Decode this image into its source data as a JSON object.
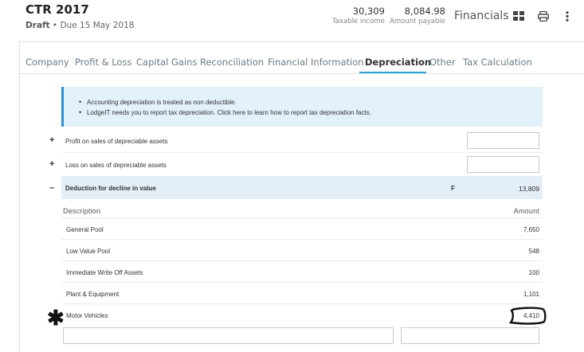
{
  "header": {
    "title": "CTR 2017",
    "status": "Draft",
    "due": "• Due 15 May 2018",
    "taxable_income_value": "30,309",
    "taxable_income_label": "Taxable income",
    "amount_payable_value": "8,084.98",
    "amount_payable_label": "Amount payable",
    "financials_label": "Financials",
    "icons": [
      "grid-icon",
      "print-icon",
      "more-vertical-icon"
    ]
  },
  "tabs": [
    "Company",
    "Profit & Loss",
    "Capital Gains",
    "Reconciliation",
    "Financial Information",
    "Depreciation",
    "Other",
    "Tax Calculation"
  ],
  "active_tab": "Depreciation",
  "info": {
    "lines": [
      "Accounting depreciation is treated as non deductible.",
      "LodgeIT needs you to report tax depreciation. Click here to learn how to report tax depreciation facts."
    ]
  },
  "rows": {
    "profit": {
      "toggle": "+",
      "label": "Profit on sales of depreciable assets",
      "value": ""
    },
    "loss": {
      "toggle": "+",
      "label": "Loss on sales of depreciable assets",
      "value": ""
    },
    "deduction": {
      "toggle": "–",
      "label": "Deduction for decline in value",
      "code": "F",
      "value": "13,809"
    }
  },
  "breakdown": {
    "col_description": "Description",
    "col_amount": "Amount",
    "items": [
      {
        "label": "General Pool",
        "amount": "7,650"
      },
      {
        "label": "Low Value Pool",
        "amount": "548"
      },
      {
        "label": "Immediate Write Off Assets",
        "amount": "100"
      },
      {
        "label": "Plant & Equipment",
        "amount": "1,101"
      },
      {
        "label": "Motor Vehicles",
        "amount": "4,410"
      }
    ]
  },
  "annotation": {
    "mark": "✱"
  },
  "colors": {
    "accent": "#2aa4d8",
    "info_bg": "#e3f1fb",
    "shaded_row": "#e4eef7"
  }
}
